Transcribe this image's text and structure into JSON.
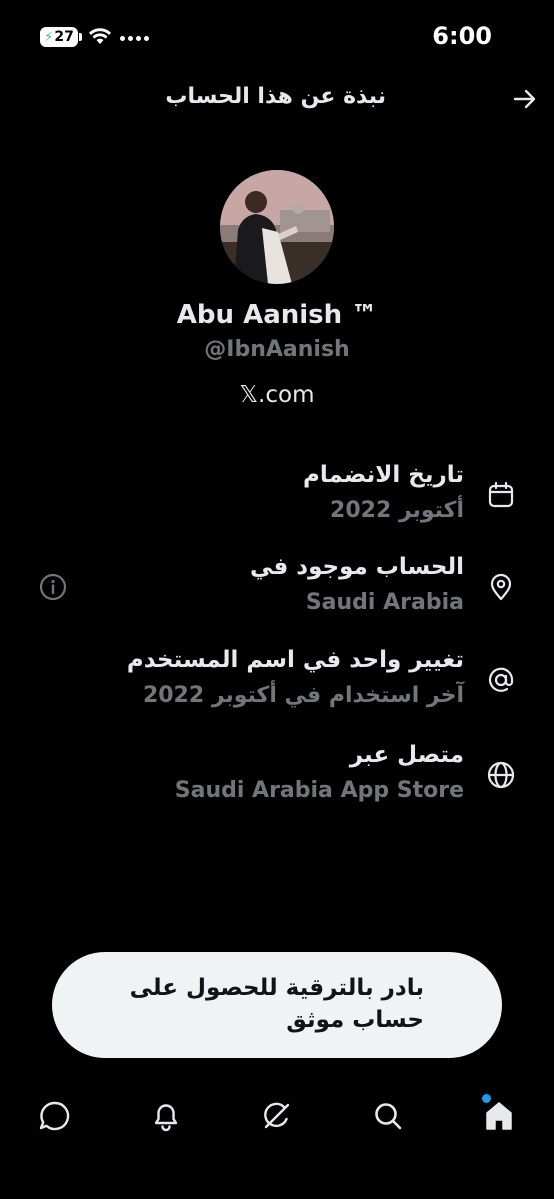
{
  "status_bar": {
    "battery": "27",
    "time": "6:00"
  },
  "header": {
    "title": "نبذة عن هذا الحساب",
    "back_icon": "arrow-right-icon"
  },
  "profile": {
    "display_name": "Abu Aanish ™",
    "handle": "@IbnAanish",
    "site": "𝕏.com"
  },
  "info": {
    "joined_title": "تاريخ الانضمام",
    "joined_value": "أكتوبر 2022",
    "location_title": "الحساب موجود في",
    "location_value": "Saudi Arabia",
    "username_title": "تغيير واحد في اسم المستخدم",
    "username_value": "آخر استخدام في أكتوبر 2022",
    "connected_title": "متصل عبر",
    "connected_value": "Saudi Arabia App Store"
  },
  "upgrade": {
    "label": "بادر بالترقية للحصول على حساب موثق"
  },
  "nav": {
    "items": [
      "home-icon",
      "search-icon",
      "grok-icon",
      "bell-icon",
      "chat-icon"
    ],
    "accent": "#1d9bf0"
  }
}
